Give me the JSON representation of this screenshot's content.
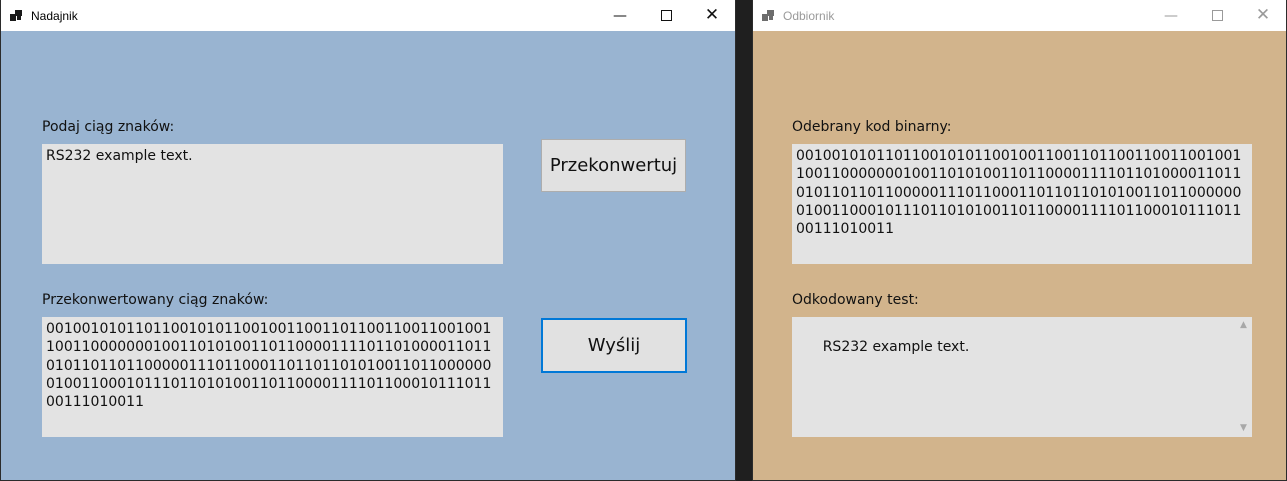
{
  "sender": {
    "title": "Nadajnik",
    "input_label": "Podaj ciąg znaków:",
    "input_value": "RS232 example text.",
    "convert_button": "Przekonwertuj",
    "converted_label": "Przekonwertowany ciąg znaków:",
    "converted_value": "0010010101101100101011001001100110110011001100100110011000000010011010100110110000111101101000011011010110110110000011101100011011011010100110110000000100110001011101101010011011000011110110001011101100111010011",
    "send_button": "Wyślij",
    "caption": {
      "minimize": "—",
      "close": "✕"
    }
  },
  "receiver": {
    "title": "Odbiornik",
    "binary_label": "Odebrany kod binarny:",
    "binary_value": "0010010101101100101011001001100110110011001100100110011000000010011010100110110000111101101000011011010110110110000011101100011011011010100110110000000100110001011101101010011011000011110110001011101100111010011",
    "decoded_label": "Odkodowany test:",
    "decoded_value": "RS232 example text.",
    "scroll_up": "▲",
    "scroll_down": "▼",
    "caption": {
      "minimize": "—",
      "close": "✕"
    }
  },
  "colors": {
    "sender_bg": "#99b4d1",
    "receiver_bg": "#d2b48c",
    "textbox_bg": "#e3e3e3",
    "focus_border": "#0078d7"
  },
  "icons": {
    "app": "app-icon",
    "minimize": "minimize-icon",
    "maximize": "maximize-icon",
    "close": "close-icon"
  }
}
